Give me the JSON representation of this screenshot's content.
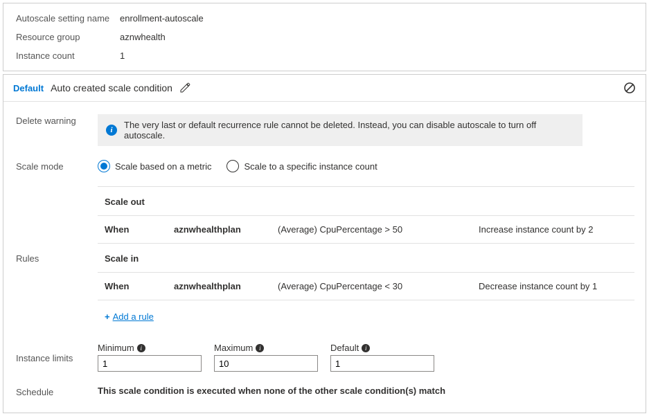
{
  "summary": {
    "setting_name_label": "Autoscale setting name",
    "setting_name_value": "enrollment-autoscale",
    "resource_group_label": "Resource group",
    "resource_group_value": "aznwhealth",
    "instance_count_label": "Instance count",
    "instance_count_value": "1"
  },
  "condition": {
    "default_label": "Default",
    "title": "Auto created scale condition",
    "delete_warning_label": "Delete warning",
    "delete_warning_text": "The very last or default recurrence rule cannot be deleted. Instead, you can disable autoscale to turn off autoscale.",
    "scale_mode_label": "Scale mode",
    "scale_mode_options": {
      "metric": "Scale based on a metric",
      "specific": "Scale to a specific instance count"
    },
    "rules_label": "Rules",
    "rules": {
      "scale_out_heading": "Scale out",
      "scale_in_heading": "Scale in",
      "when_label": "When",
      "out": {
        "resource": "aznwhealthplan",
        "condition": "(Average) CpuPercentage > 50",
        "action": "Increase instance count by 2"
      },
      "in": {
        "resource": "aznwhealthplan",
        "condition": "(Average) CpuPercentage < 30",
        "action": "Decrease instance count by 1"
      },
      "add_rule_label": "Add a rule"
    },
    "limits_label": "Instance limits",
    "limits": {
      "min_label": "Minimum",
      "min_value": "1",
      "max_label": "Maximum",
      "max_value": "10",
      "default_label": "Default",
      "default_value": "1"
    },
    "schedule_label": "Schedule",
    "schedule_text": "This scale condition is executed when none of the other scale condition(s) match"
  }
}
